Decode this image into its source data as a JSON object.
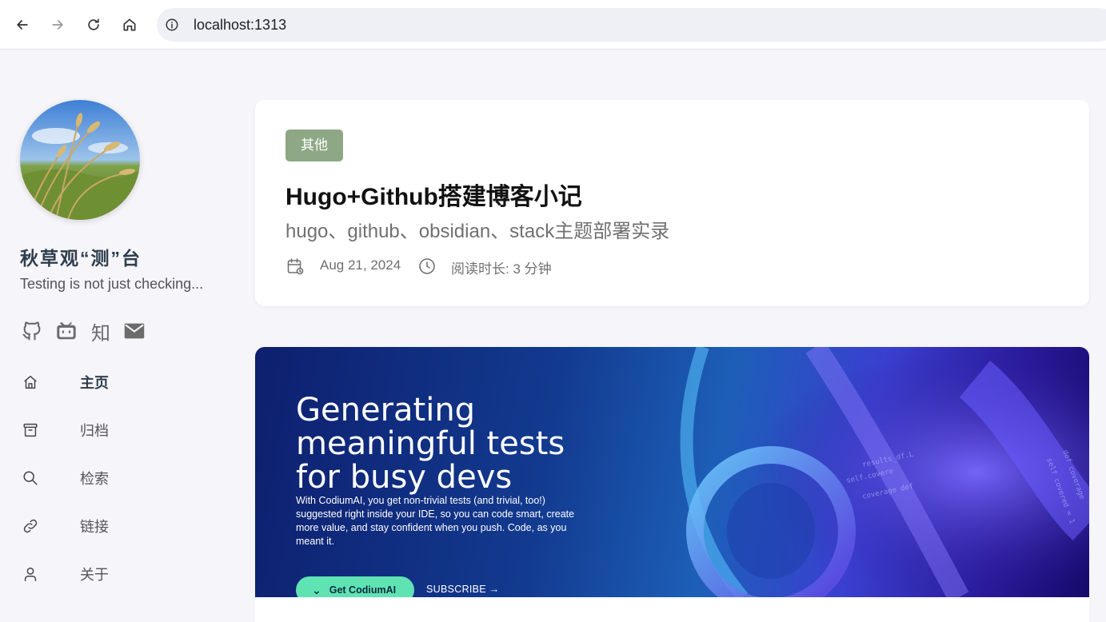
{
  "browser": {
    "url": "localhost:1313"
  },
  "sidebar": {
    "site_name": "秋草观“测”台",
    "description": "Testing is not just checking...",
    "social": {
      "zhihu": "知"
    },
    "menu": [
      {
        "label": "主页",
        "icon": "home-icon",
        "active": true
      },
      {
        "label": "归档",
        "icon": "archive-icon",
        "active": false
      },
      {
        "label": "检索",
        "icon": "search-icon",
        "active": false
      },
      {
        "label": "链接",
        "icon": "link-icon",
        "active": false
      },
      {
        "label": "关于",
        "icon": "user-icon",
        "active": false
      }
    ]
  },
  "article": {
    "category": "其他",
    "title": "Hugo+Github搭建博客小记",
    "subtitle": "hugo、github、obsidian、stack主题部署实录",
    "date": "Aug 21, 2024",
    "reading_time": "阅读时长: 3 分钟"
  },
  "banner": {
    "headline_1": "Generating",
    "headline_2": "meaningful tests",
    "headline_3": "for busy devs",
    "body": "With CodiumAI, you get non-trivial tests (and trivial, too!) suggested right inside your IDE, so you can code smart, create more value, and stay confident when you push. Code, as you meant it.",
    "cta": "Get CodiumAI",
    "subscribe": "SUBSCRIBE →"
  },
  "colors": {
    "tag": "#8ea885",
    "cta": "#5fe3b3",
    "page_bg": "#f5f5fa"
  }
}
